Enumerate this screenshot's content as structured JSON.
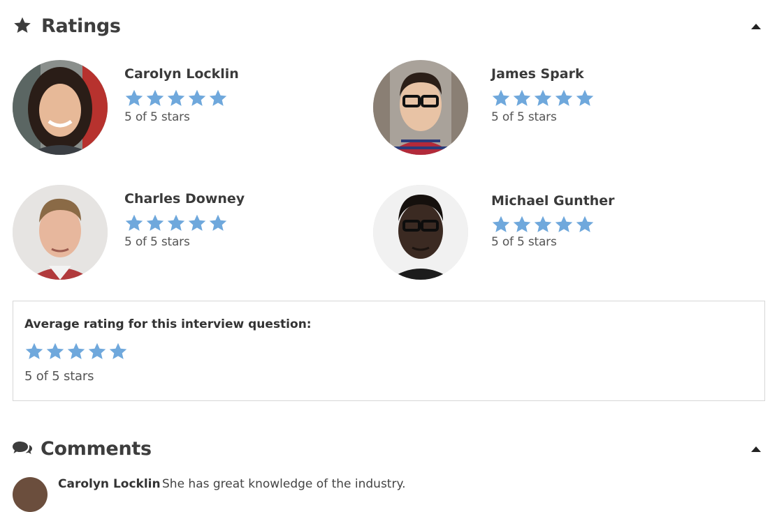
{
  "ratings_section": {
    "title": "Ratings",
    "icon": "star-icon",
    "collapse_icon": "caret-up-icon"
  },
  "accent_color": "#6fa8dc",
  "reviewers": [
    {
      "name": "Carolyn Locklin",
      "stars": 5,
      "max_stars": 5,
      "rating_text": "5 of 5 stars"
    },
    {
      "name": "James Spark",
      "stars": 5,
      "max_stars": 5,
      "rating_text": "5 of 5 stars"
    },
    {
      "name": "Charles Downey",
      "stars": 5,
      "max_stars": 5,
      "rating_text": "5 of 5 stars"
    },
    {
      "name": "Michael Gunther",
      "stars": 5,
      "max_stars": 5,
      "rating_text": "5 of 5 stars"
    }
  ],
  "average": {
    "label": "Average rating for this interview question:",
    "stars": 5,
    "max_stars": 5,
    "rating_text": "5 of 5 stars"
  },
  "comments_section": {
    "title": "Comments",
    "icon": "speech-bubbles-icon",
    "collapse_icon": "caret-up-icon"
  },
  "comments": [
    {
      "author": "Carolyn Locklin",
      "text": "She has great knowledge of the industry."
    }
  ]
}
